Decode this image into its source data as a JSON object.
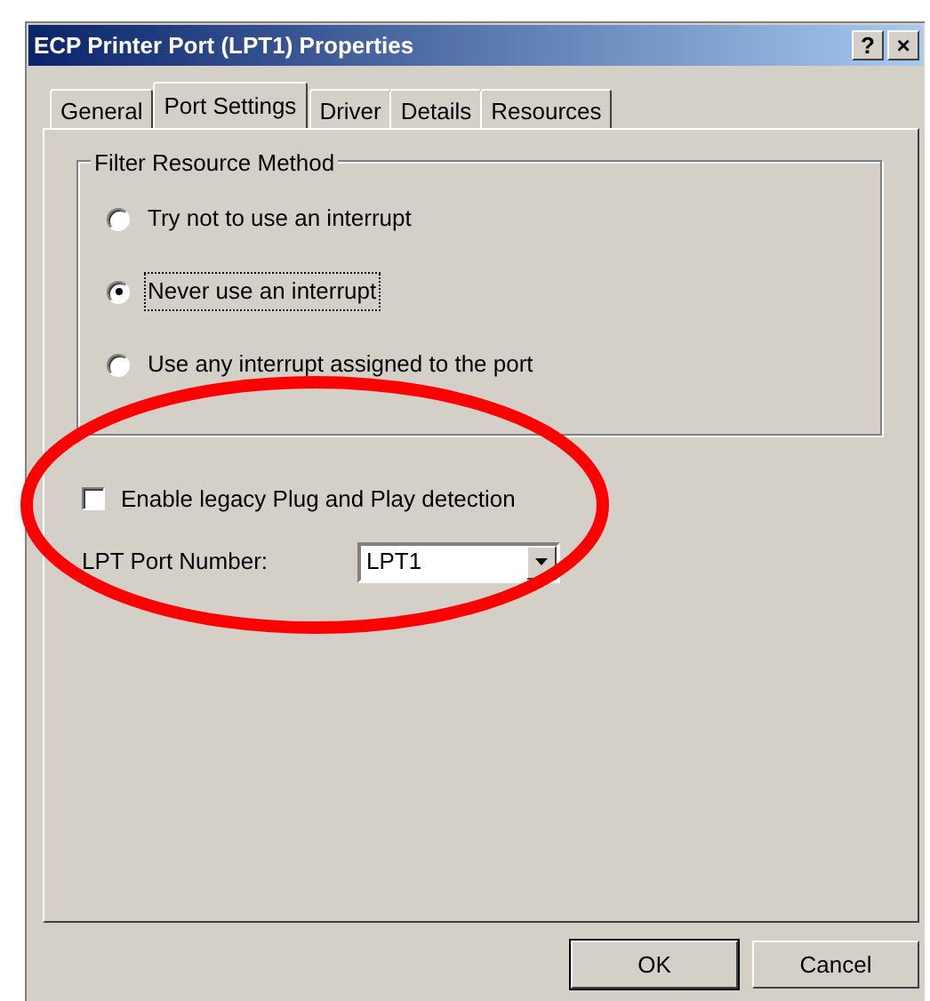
{
  "window": {
    "title": "ECP Printer Port (LPT1) Properties",
    "title_buttons": [
      "?",
      "×"
    ]
  },
  "tabs": [
    {
      "label": "General",
      "selected": false
    },
    {
      "label": "Port Settings",
      "selected": true
    },
    {
      "label": "Driver",
      "selected": false
    },
    {
      "label": "Details",
      "selected": false
    },
    {
      "label": "Resources",
      "selected": false
    }
  ],
  "filter_group": {
    "title": "Filter Resource Method",
    "options": [
      {
        "label": "Try not to use an interrupt",
        "selected": false,
        "focused": false
      },
      {
        "label": "Never use an interrupt",
        "selected": true,
        "focused": true
      },
      {
        "label": "Use any interrupt assigned to the port",
        "selected": false,
        "focused": false
      }
    ]
  },
  "legacy_detection": {
    "label": "Enable legacy Plug and Play detection",
    "checked": false
  },
  "port_number": {
    "label": "LPT Port Number:",
    "value": "LPT1"
  },
  "buttons": [
    "OK",
    "Cancel"
  ],
  "annotation": {
    "kind": "ellipse"
  }
}
